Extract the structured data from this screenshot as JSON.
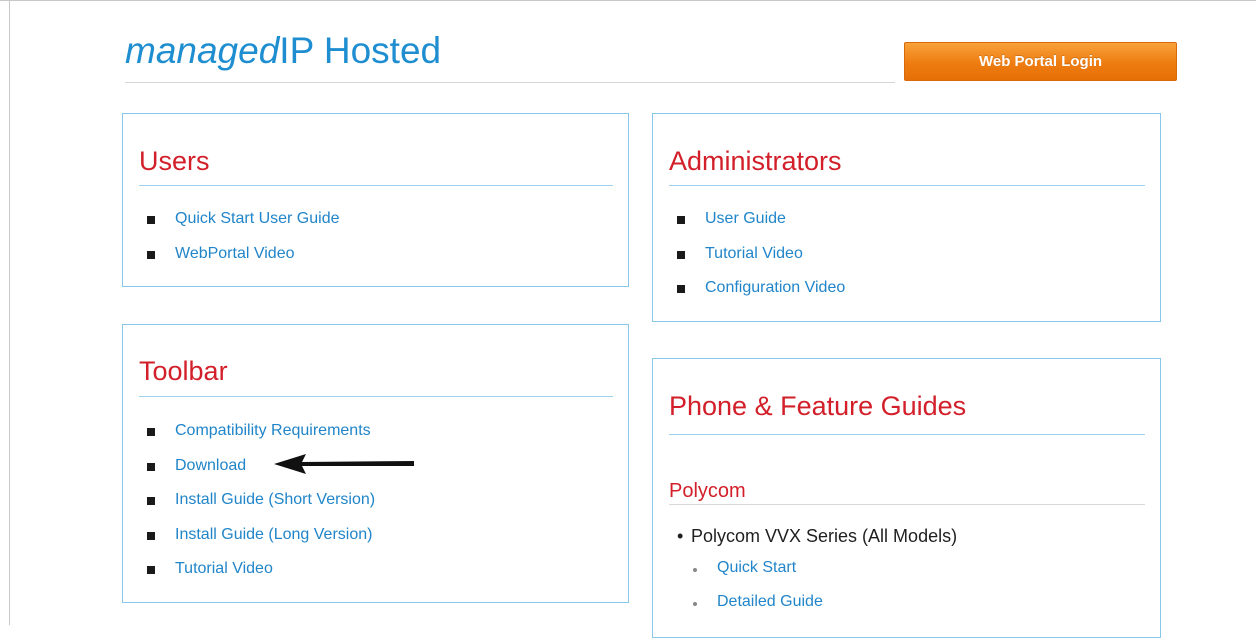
{
  "header": {
    "title_italic": "managed",
    "title_rest": "IP Hosted",
    "login_button": "Web Portal Login"
  },
  "users": {
    "heading": "Users",
    "links": [
      "Quick Start User Guide",
      "WebPortal Video"
    ]
  },
  "administrators": {
    "heading": "Administrators",
    "links": [
      "User Guide",
      "Tutorial Video",
      "Configuration Video"
    ]
  },
  "toolbar": {
    "heading": "Toolbar",
    "links": [
      "Compatibility Requirements",
      "Download",
      "Install Guide (Short Version)",
      "Install Guide (Long Version)",
      "Tutorial Video"
    ]
  },
  "phones": {
    "heading": "Phone & Feature Guides",
    "vendor": "Polycom",
    "series": "Polycom VVX Series (All Models)",
    "series_links": [
      "Quick Start",
      "Detailed Guide"
    ]
  },
  "colors": {
    "title_blue": "#1e8ed1",
    "heading_red": "#d21f29",
    "link_blue": "#2185c9",
    "panel_border": "#89c7ea",
    "button_orange": "#ee7c11"
  },
  "icons": [
    "square-bullet-icon",
    "arrow-left-icon"
  ]
}
